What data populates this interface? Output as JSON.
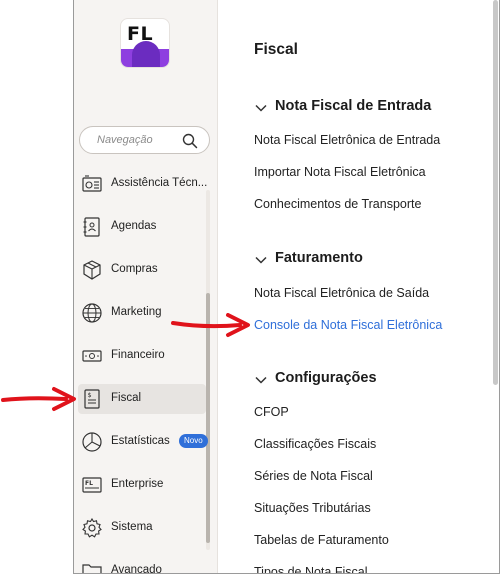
{
  "logo": {
    "text": "FL"
  },
  "search": {
    "placeholder": "Navegação"
  },
  "sidebar": {
    "items": [
      {
        "label": "Assistência Técn..."
      },
      {
        "label": "Agendas"
      },
      {
        "label": "Compras"
      },
      {
        "label": "Marketing"
      },
      {
        "label": "Financeiro"
      },
      {
        "label": "Fiscal"
      },
      {
        "label": "Estatísticas",
        "badge": "Novo"
      },
      {
        "label": "Enterprise"
      },
      {
        "label": "Sistema"
      },
      {
        "label": "Avançado"
      }
    ]
  },
  "main": {
    "title": "Fiscal",
    "sections": [
      {
        "title": "Nota Fiscal de Entrada",
        "links": [
          "Nota Fiscal Eletrônica de Entrada",
          "Importar Nota Fiscal Eletrônica",
          "Conhecimentos de Transporte"
        ]
      },
      {
        "title": "Faturamento",
        "links": [
          "Nota Fiscal Eletrônica de Saída",
          "Console da Nota Fiscal Eletrônica"
        ]
      },
      {
        "title": "Configurações",
        "links": [
          "CFOP",
          "Classificações Fiscais",
          "Séries de Nota Fiscal",
          "Situações Tributárias",
          "Tabelas de Faturamento",
          "Tipos de Nota Fiscal"
        ]
      }
    ]
  },
  "colors": {
    "accent": "#2f6fd9",
    "arrow": "#e0131b",
    "logo_purple": "#8e3fe0",
    "sidebar_bg": "#f6f4f2"
  }
}
